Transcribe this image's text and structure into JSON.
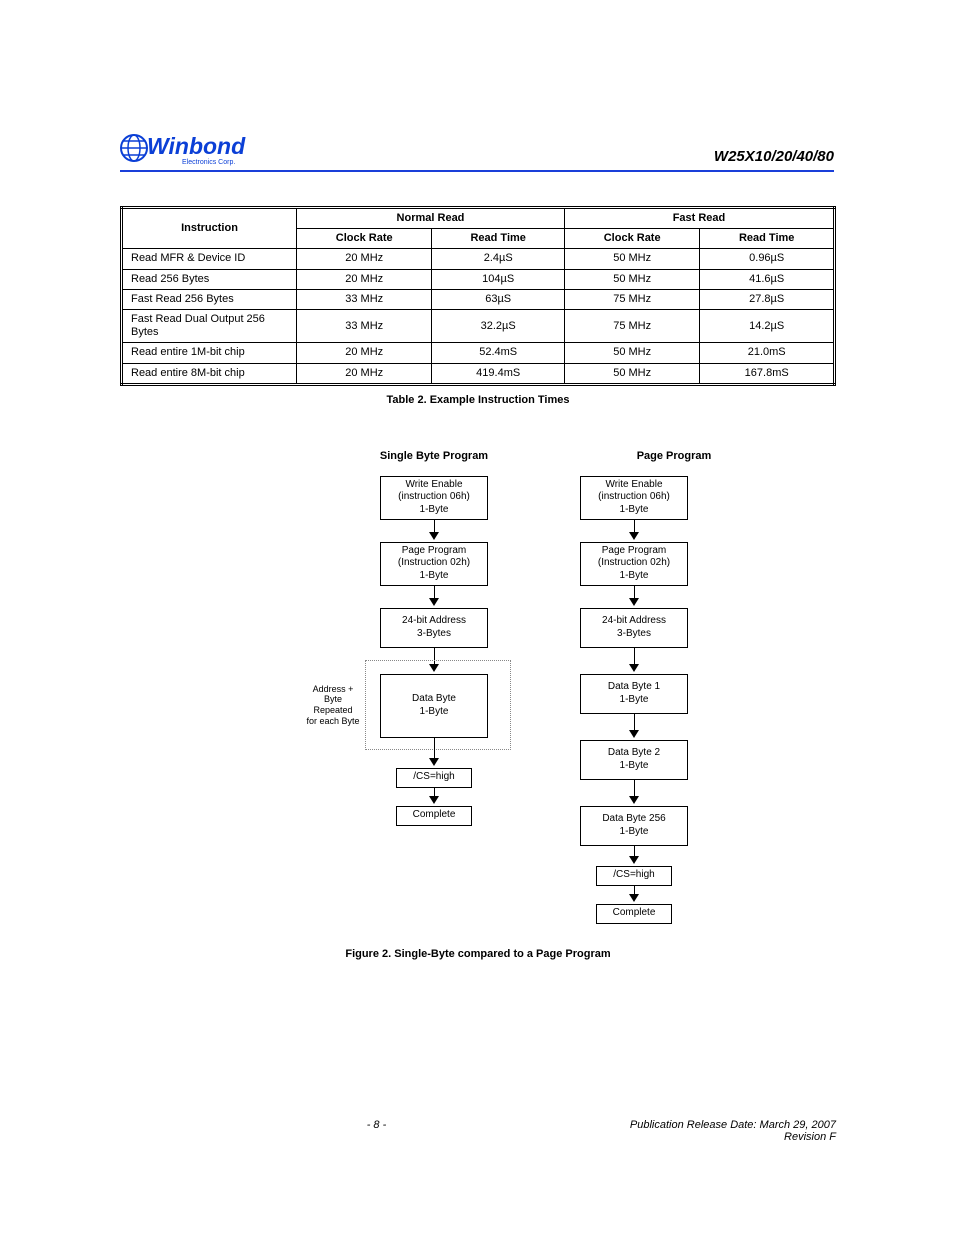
{
  "header": {
    "logo_text": "Winbond",
    "logo_sub": "Electronics Corp.",
    "part_number": "W25X10/20/40/80"
  },
  "table": {
    "col_headers": {
      "instruction": "Instruction",
      "normal": "Normal Read",
      "fast": "Fast Read",
      "clock": "Clock Rate",
      "time_norm": "Read Time",
      "time_fast": "Read Time"
    },
    "rows": [
      {
        "inst": "Read MFR & Device ID",
        "nclock": "20 MHz",
        "ntime": "2.4µS",
        "fclock": "50 MHz",
        "ftime": "0.96µS"
      },
      {
        "inst": "Read 256 Bytes",
        "nclock": "20 MHz",
        "ntime": "104µS",
        "fclock": "50 MHz",
        "ftime": "41.6µS"
      },
      {
        "inst": "Fast Read 256 Bytes",
        "nclock": "33 MHz",
        "ntime": "63µS",
        "fclock": "75 MHz",
        "ftime": "27.8µS"
      },
      {
        "inst": "Fast Read Dual Output 256 Bytes",
        "nclock": "33 MHz",
        "ntime": "32.2µS",
        "fclock": "75 MHz",
        "ftime": "14.2µS"
      },
      {
        "inst": "Read entire 1M-bit chip",
        "nclock": "20 MHz",
        "ntime": "52.4mS",
        "fclock": "50 MHz",
        "ftime": "21.0mS"
      },
      {
        "inst": "Read entire 8M-bit chip",
        "nclock": "20 MHz",
        "ntime": "419.4mS",
        "fclock": "50 MHz",
        "ftime": "167.8mS"
      }
    ]
  },
  "table_caption": "Table 2.   Example Instruction Times",
  "flows": {
    "left": {
      "title": "Single Byte Program",
      "boxes": [
        "Write Enable\n(instruction 06h)\n1-Byte",
        "Page Program\n(Instruction 02h)\n1-Byte",
        "24-bit Address\n3-Bytes",
        "Data Byte\n1-Byte",
        "/CS=high",
        "Complete"
      ],
      "loop_label": "Address + Byte\nRepeated\nfor each Byte"
    },
    "right": {
      "title": "Page Program",
      "boxes": [
        "Write Enable\n(instruction 06h)\n1-Byte",
        "Page Program\n(Instruction 02h)\n1-Byte",
        "24-bit Address\n3-Bytes",
        "Data Byte 1\n1-Byte",
        "Data Byte 2\n1-Byte",
        "Data Byte 256\n1-Byte",
        "/CS=high",
        "Complete"
      ]
    }
  },
  "flow_caption": "Figure 2.   Single-Byte compared to a Page Program",
  "footer": {
    "pub": "Publication Release Date: March 29, 2007",
    "page": "- 8 -",
    "rev": "Revision F"
  }
}
